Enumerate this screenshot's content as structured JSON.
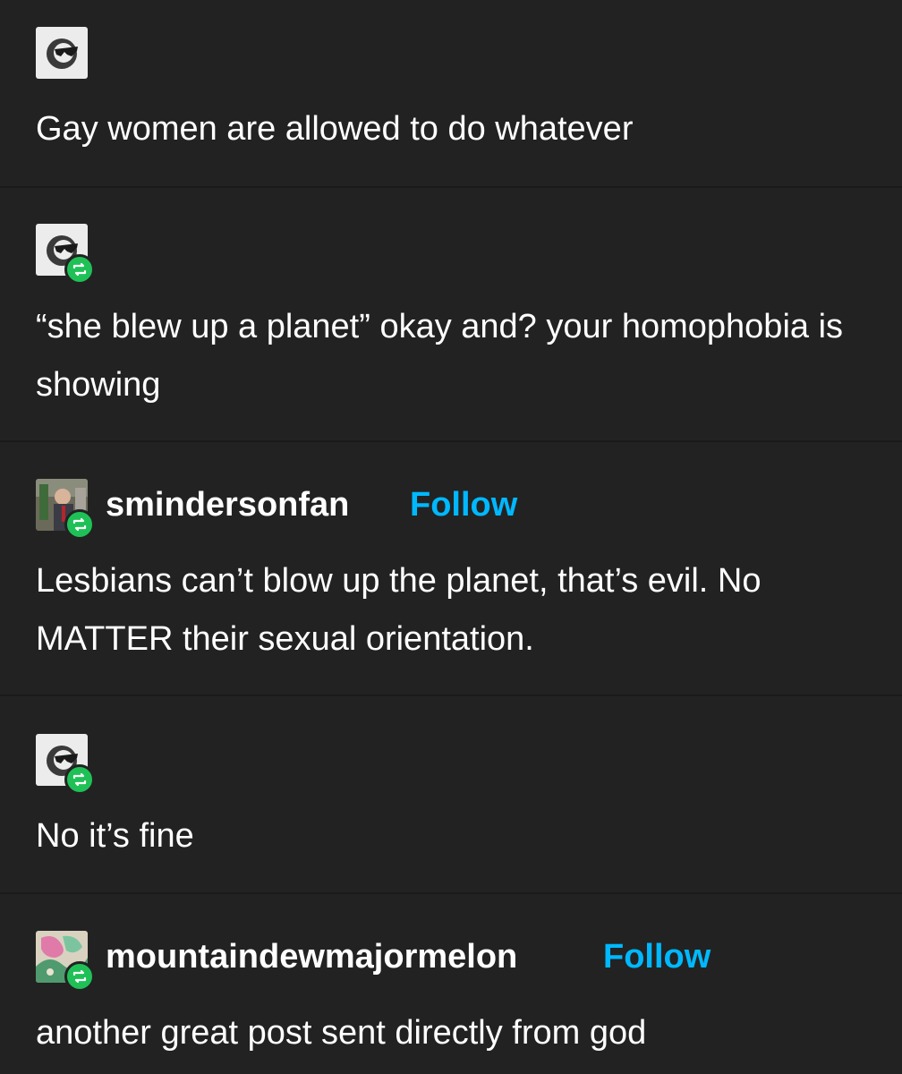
{
  "colors": {
    "background": "#222222",
    "text": "#ffffff",
    "follow": "#00b8ff",
    "reblog_badge": "#1fc157"
  },
  "posts": [
    {
      "avatar_icon": "sunglasses-avatar",
      "reblog": false,
      "body": "Gay women are allowed to do whatever"
    },
    {
      "avatar_icon": "sunglasses-avatar",
      "reblog": true,
      "body": "“she blew up a planet” okay and? your homophobia is showing"
    },
    {
      "avatar_icon": "photo-avatar",
      "reblog": true,
      "username": "smindersonfan",
      "follow_label": "Follow",
      "body": "Lesbians can’t blow up the planet, that’s evil. No MATTER their sexual orientation."
    },
    {
      "avatar_icon": "sunglasses-avatar",
      "reblog": true,
      "body": "No it’s fine"
    },
    {
      "avatar_icon": "art-avatar",
      "reblog": true,
      "username": "mountaindewmajormelon",
      "follow_label": "Follow",
      "body": "another great post sent directly from god"
    }
  ]
}
